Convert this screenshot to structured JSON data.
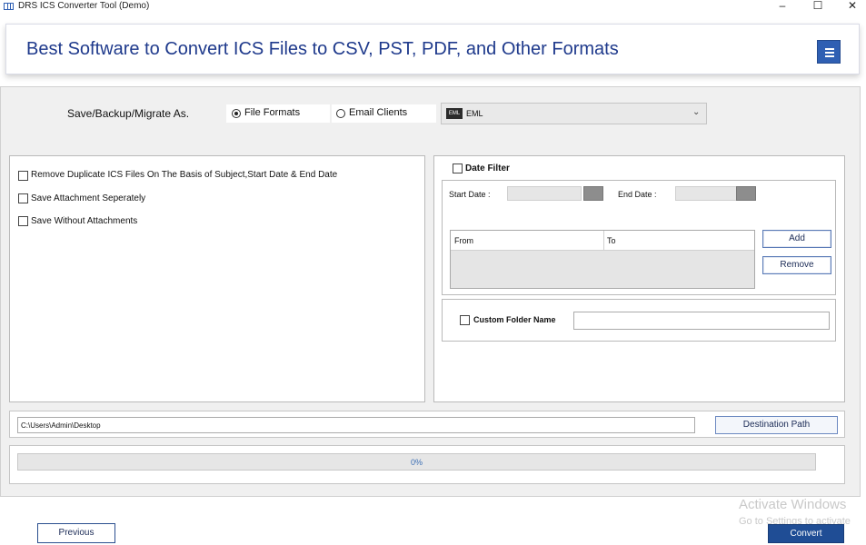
{
  "window": {
    "title": "DRS ICS Converter Tool (Demo)",
    "minimize_glyph": "–",
    "maximize_glyph": "☐",
    "close_glyph": "✕"
  },
  "banner": {
    "title": "Best Software to Convert ICS Files to CSV, PST, PDF, and Other Formats",
    "menu_icon": "hamburger-icon"
  },
  "save_as": {
    "label": "Save/Backup/Migrate As.",
    "options": [
      {
        "label": "File Formats",
        "selected": true
      },
      {
        "label": "Email Clients",
        "selected": false
      }
    ],
    "format_icon_text": "EML",
    "format_value": "EML",
    "chevron": "⌄"
  },
  "options": [
    {
      "label": "Remove Duplicate ICS Files On The Basis of Subject,Start Date & End Date",
      "checked": false
    },
    {
      "label": "Save Attachment Seperately",
      "checked": false
    },
    {
      "label": "Save Without Attachments",
      "checked": false
    }
  ],
  "date_filter": {
    "label": "Date Filter",
    "checked": false,
    "start_label": "Start Date :",
    "end_label": "End Date :",
    "columns": [
      "From",
      "To"
    ],
    "add_label": "Add",
    "remove_label": "Remove"
  },
  "custom_folder": {
    "label": "Custom Folder Name",
    "checked": false,
    "value": ""
  },
  "destination": {
    "path": "C:\\Users\\Admin\\Desktop",
    "button_label": "Destination Path"
  },
  "progress": {
    "percent": 0,
    "text": "0%"
  },
  "footer": {
    "previous_label": "Previous",
    "convert_label": "Convert"
  },
  "watermark": {
    "title": "Activate Windows",
    "subtitle": "Go to Settings to activate"
  },
  "colors": {
    "accent": "#1f4d95",
    "banner_text": "#1f3a8c",
    "progress_fill": "#3c7fd0"
  }
}
